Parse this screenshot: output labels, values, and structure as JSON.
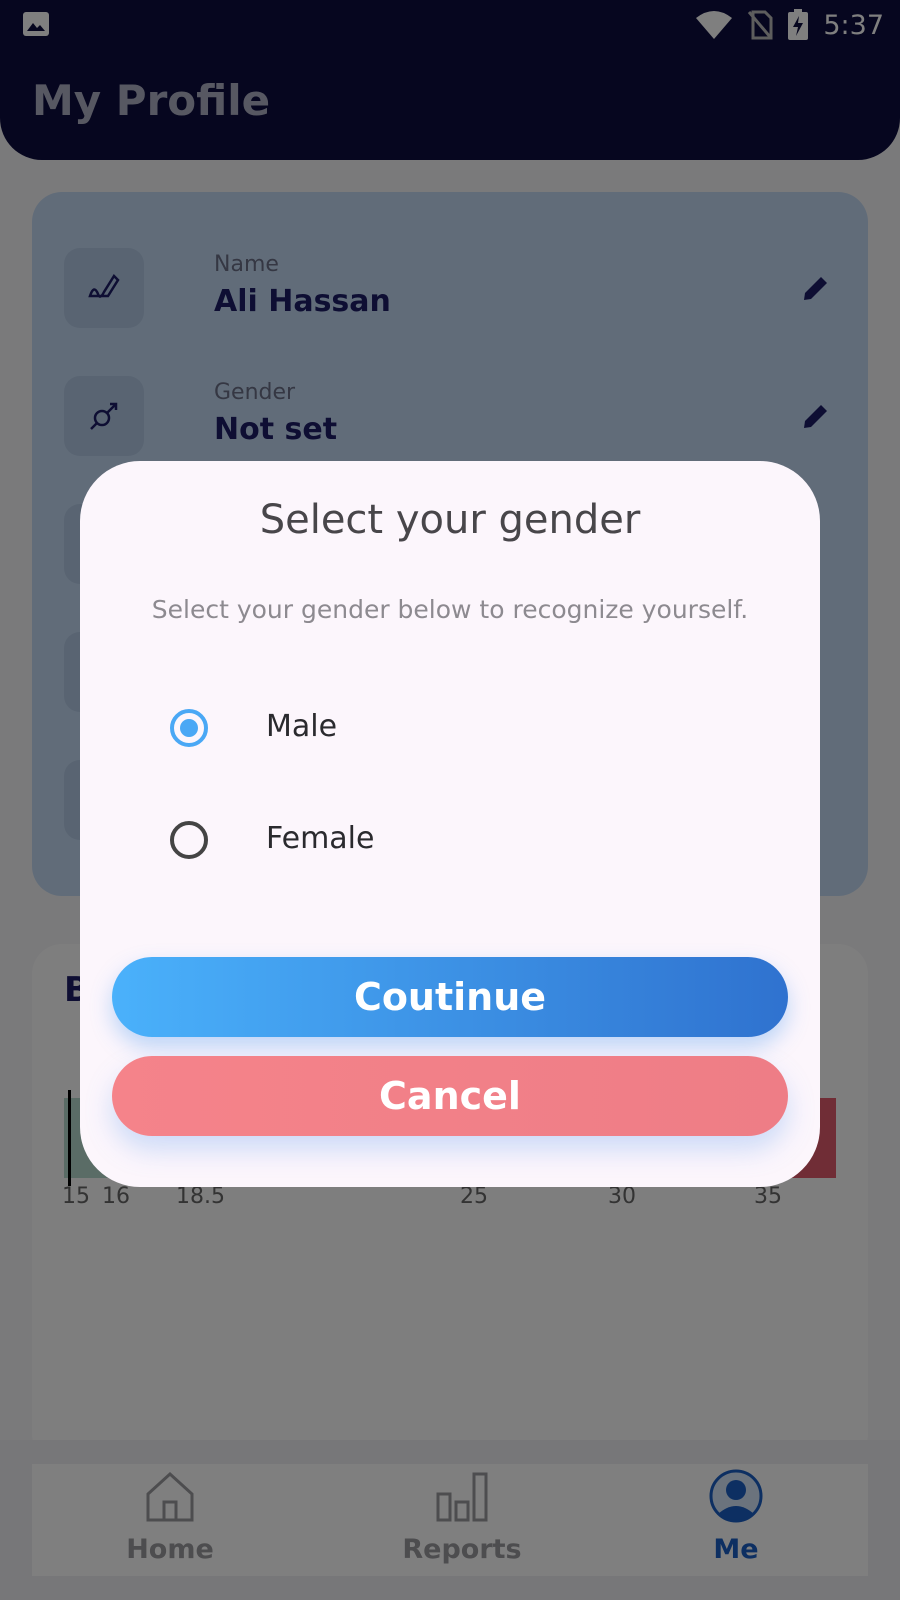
{
  "status_bar": {
    "time": "5:37"
  },
  "header": {
    "title": "My Profile"
  },
  "profile": {
    "rows": [
      {
        "label": "Name",
        "value": "Ali Hassan",
        "icon": "signature-icon"
      },
      {
        "label": "Gender",
        "value": "Not set",
        "icon": "gender-icon"
      }
    ]
  },
  "bmi": {
    "title_partial": "B",
    "scale_ticks": [
      "15",
      "16",
      "18.5",
      "25",
      "30",
      "35"
    ],
    "colors": {
      "underweight": "#b5d8cc",
      "normal": "#b5d8cc",
      "obese": "#e05a6c"
    }
  },
  "nav": {
    "items": [
      {
        "label": "Home",
        "icon": "home-icon",
        "active": false
      },
      {
        "label": "Reports",
        "icon": "reports-icon",
        "active": false
      },
      {
        "label": "Me",
        "icon": "person-icon",
        "active": true
      }
    ]
  },
  "dialog": {
    "title": "Select your gender",
    "subtitle": "Select your gender below to recognize yourself.",
    "options": [
      {
        "label": "Male",
        "selected": true
      },
      {
        "label": "Female",
        "selected": false
      }
    ],
    "continue_label": "Coutinue",
    "cancel_label": "Cancel"
  },
  "colors": {
    "primary_dark": "#0d0d3e",
    "accent_blue": "#4aa8f5",
    "cancel_red": "#f5838a"
  }
}
